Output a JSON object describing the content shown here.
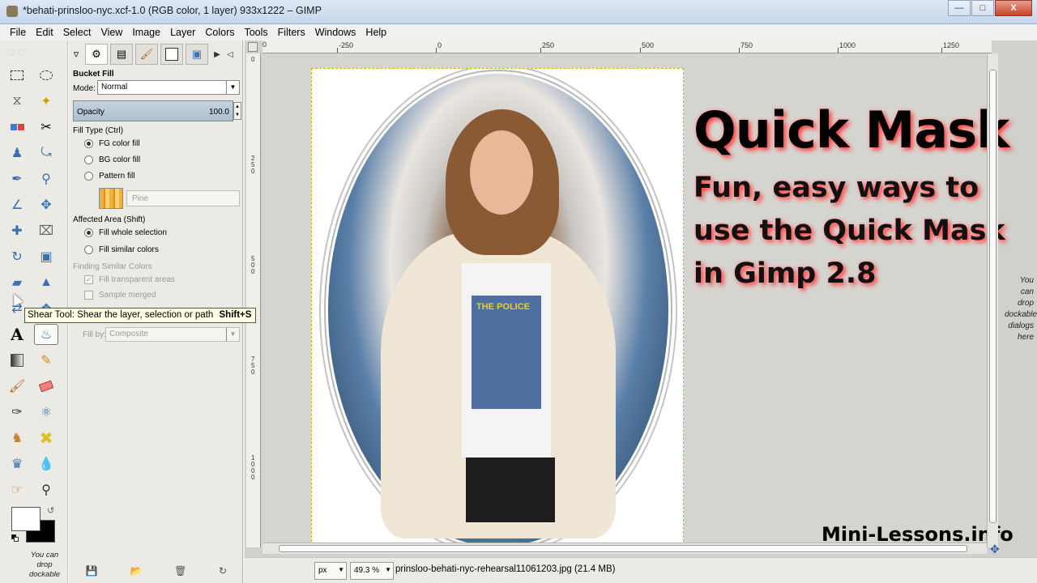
{
  "window": {
    "title": "*behati-prinsloo-nyc.xcf-1.0 (RGB color, 1 layer) 933x1222 – GIMP",
    "minimize": "—",
    "maximize": "□",
    "close": "X"
  },
  "menu": [
    "File",
    "Edit",
    "Select",
    "View",
    "Image",
    "Layer",
    "Colors",
    "Tools",
    "Filters",
    "Windows",
    "Help"
  ],
  "toolbox": {
    "tools": [
      "rect-select",
      "ellipse-select",
      "free-select",
      "fuzzy-select",
      "select-by-color",
      "scissors-select",
      "foreground-select",
      "paths",
      "color-picker",
      "zoom",
      "measure",
      "move",
      "align",
      "crop",
      "rotate",
      "scale",
      "shear",
      "perspective",
      "flip",
      "cage-transform",
      "text",
      "bucket-fill",
      "blend",
      "pencil",
      "paintbrush",
      "eraser",
      "airbrush",
      "ink",
      "clone",
      "heal",
      "perspective-clone",
      "blur-sharpen",
      "smudge",
      "dodge-burn"
    ],
    "drop_hint": "You can drop dockable"
  },
  "tool_options": {
    "title": "Bucket Fill",
    "mode_label": "Mode:",
    "mode_value": "Normal",
    "opacity_label": "Opacity",
    "opacity_value": "100.0",
    "fill_type_label": "Fill Type  (Ctrl)",
    "fill_types": [
      "FG color fill",
      "BG color fill",
      "Pattern fill"
    ],
    "pattern_name": "Pine",
    "affected_area_label": "Affected Area  (Shift)",
    "affected_areas": [
      "Fill whole selection",
      "Fill similar colors"
    ],
    "finding_label": "Finding Similar Colors",
    "fill_transparent": "Fill transparent areas",
    "sample_merged": "Sample merged",
    "fill_by_label": "Fill by:",
    "fill_by_value": "Composite"
  },
  "tooltip": {
    "text": "Shear Tool: Shear the layer, selection or path",
    "shortcut": "Shift+S"
  },
  "rulers": {
    "h_ticks": [
      "0",
      "-250",
      "0",
      "250",
      "500",
      "750",
      "1000",
      "1250"
    ],
    "v_ticks": [
      "0",
      "250",
      "500",
      "750",
      "1000"
    ]
  },
  "canvas": {
    "title": "Quick Mask",
    "subtitle_lines": [
      "Fun, easy ways to",
      "use the Quick Mask",
      "in Gimp 2.8"
    ],
    "site": "Mini-Lessons.info",
    "tshirt_text": "THE POLICE"
  },
  "statusbar": {
    "unit": "px",
    "zoom": "49.3 %",
    "file_info": "prinsloo-behati-nyc-rehearsal11061203.jpg (21.4 MB)"
  },
  "right_hint": "You can drop dockable dialogs here"
}
